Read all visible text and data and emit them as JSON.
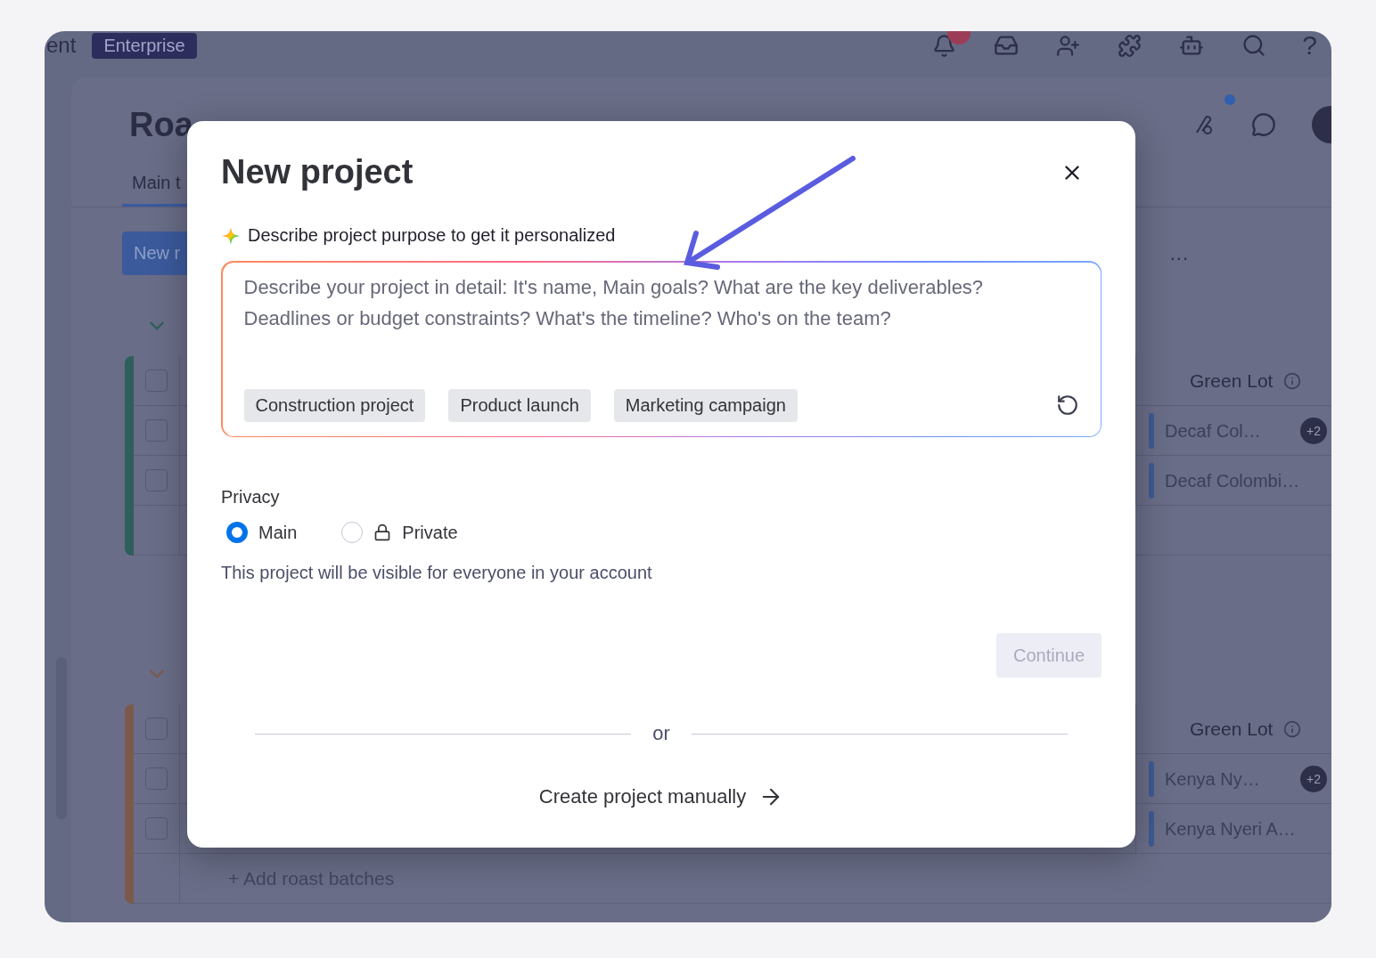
{
  "top_bar": {
    "workspace_fragment": "ent",
    "plan_badge": "Enterprise",
    "help_glyph": "?"
  },
  "board": {
    "title_fragment": "Roa",
    "tab_fragment": "Main t",
    "new_button_fragment": "New r",
    "more_glyph": "..."
  },
  "groups": [
    {
      "color": "#2e5f5a",
      "all_checked": false,
      "column_header": "Green Lot",
      "rows": [
        {
          "checked": false,
          "item": "Decaf Col…",
          "extra": "+2"
        },
        {
          "checked": false,
          "item": "Decaf Colombi…"
        }
      ]
    },
    {
      "color": "#7b5a4c",
      "all_checked": false,
      "column_header": "Green Lot",
      "rows": [
        {
          "checked": false,
          "item": "Kenya Ny…",
          "extra": "+2"
        },
        {
          "checked": false,
          "item": "Kenya Nyeri A…"
        }
      ],
      "add_label": "+ Add roast batches"
    }
  ],
  "modal": {
    "title": "New project",
    "prompt": "Describe project purpose to get it personalized",
    "description_field": {
      "placeholder": "Describe your project in detail: It's name, Main goals? What are the key deliverables? Deadlines or budget constraints? What's the timeline? Who's on the team?"
    },
    "suggestions": [
      "Construction project",
      "Product launch",
      "Marketing campaign"
    ],
    "privacy": {
      "label": "Privacy",
      "options": [
        {
          "label": "Main",
          "kind": "plain",
          "selected": true
        },
        {
          "label": "Private",
          "kind": "locked",
          "selected": false
        }
      ],
      "note": "This project will be visible for everyone in your account"
    },
    "continue_button": {
      "label": "Continue",
      "disabled": true
    },
    "separator": "or",
    "manual_link": "Create project manually"
  }
}
